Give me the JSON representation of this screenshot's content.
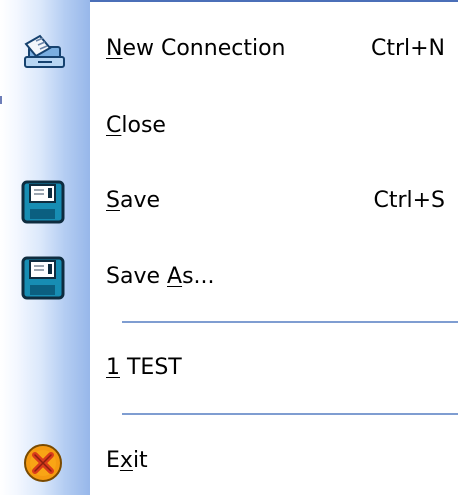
{
  "menu": {
    "items": [
      {
        "id": "new_connection",
        "label_before": "",
        "mnemonic": "N",
        "label_after": "ew Connection",
        "shortcut": "Ctrl+N",
        "icon": "new-connection-icon"
      },
      {
        "id": "close",
        "label_before": "",
        "mnemonic": "C",
        "label_after": "lose",
        "shortcut": "",
        "icon": ""
      },
      {
        "id": "save",
        "label_before": "",
        "mnemonic": "S",
        "label_after": "ave",
        "shortcut": "Ctrl+S",
        "icon": "floppy-disk-icon"
      },
      {
        "id": "save_as",
        "label_before": "Save ",
        "mnemonic": "A",
        "label_after": "s...",
        "shortcut": "",
        "icon": "floppy-disk-icon"
      },
      {
        "id": "recent_1",
        "label_before": "",
        "mnemonic": "1",
        "label_after": " TEST",
        "shortcut": "",
        "icon": ""
      },
      {
        "id": "exit",
        "label_before": "E",
        "mnemonic": "x",
        "label_after": "it",
        "shortcut": "",
        "icon": "exit-icon"
      }
    ]
  },
  "colors": {
    "gutter_light": "#ffffff",
    "gutter_dark": "#97b7ea",
    "separator": "#7f9dd1",
    "accent": "#4b6fb8",
    "disk_body": "#178db3",
    "exit_orange": "#f59a11",
    "exit_red": "#d93b1b"
  }
}
